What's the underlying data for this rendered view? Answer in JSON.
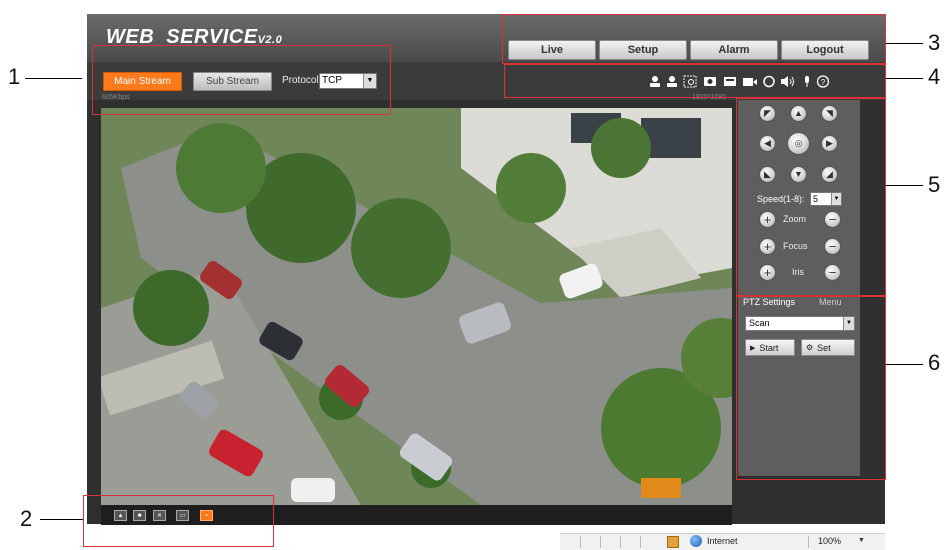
{
  "header": {
    "logo_main": "WEB  SERVICE",
    "logo_version": "V2.0",
    "tabs": [
      {
        "label": "Live",
        "active": true
      },
      {
        "label": "Setup",
        "active": false
      },
      {
        "label": "Alarm",
        "active": false
      },
      {
        "label": "Logout",
        "active": false
      }
    ]
  },
  "streambar": {
    "main_stream": "Main Stream",
    "sub_stream": "Sub Stream",
    "protocol_label": "Protocol",
    "protocol_value": "TCP",
    "bitrate": "605Kbps",
    "resolution": "1920*1080"
  },
  "toolbar_icons": [
    "user-icon",
    "user-icon",
    "zoom-icon",
    "snapshot-icon",
    "triple-snapshot-icon",
    "record-icon",
    "easy-focus-icon",
    "audio-icon",
    "microphone-icon",
    "help-icon"
  ],
  "bottom_icons": [
    "image-adjust-icon",
    "original-size-icon",
    "fullscreen-icon",
    "wh-ratio-icon",
    "fluency-icon"
  ],
  "ptz": {
    "speed_label": "Speed(1-8):",
    "speed_value": "5",
    "zoom_label": "Zoom",
    "focus_label": "Focus",
    "iris_label": "Iris",
    "plus_glyph": "+",
    "minus_glyph": "−",
    "center_glyph": "◎"
  },
  "ptz_settings": {
    "tab_settings": "PTZ Settings",
    "tab_menu": "Menu",
    "mode_value": "Scan",
    "start_label": "Start",
    "set_label": "Set"
  },
  "callouts": [
    "1",
    "2",
    "3",
    "4",
    "5",
    "6"
  ],
  "statusbar": {
    "internet": "Internet",
    "zoom": "100%"
  },
  "colors": {
    "accent": "#ff7a1a",
    "callout": "#d9323a",
    "panel": "#5e5e5e"
  }
}
